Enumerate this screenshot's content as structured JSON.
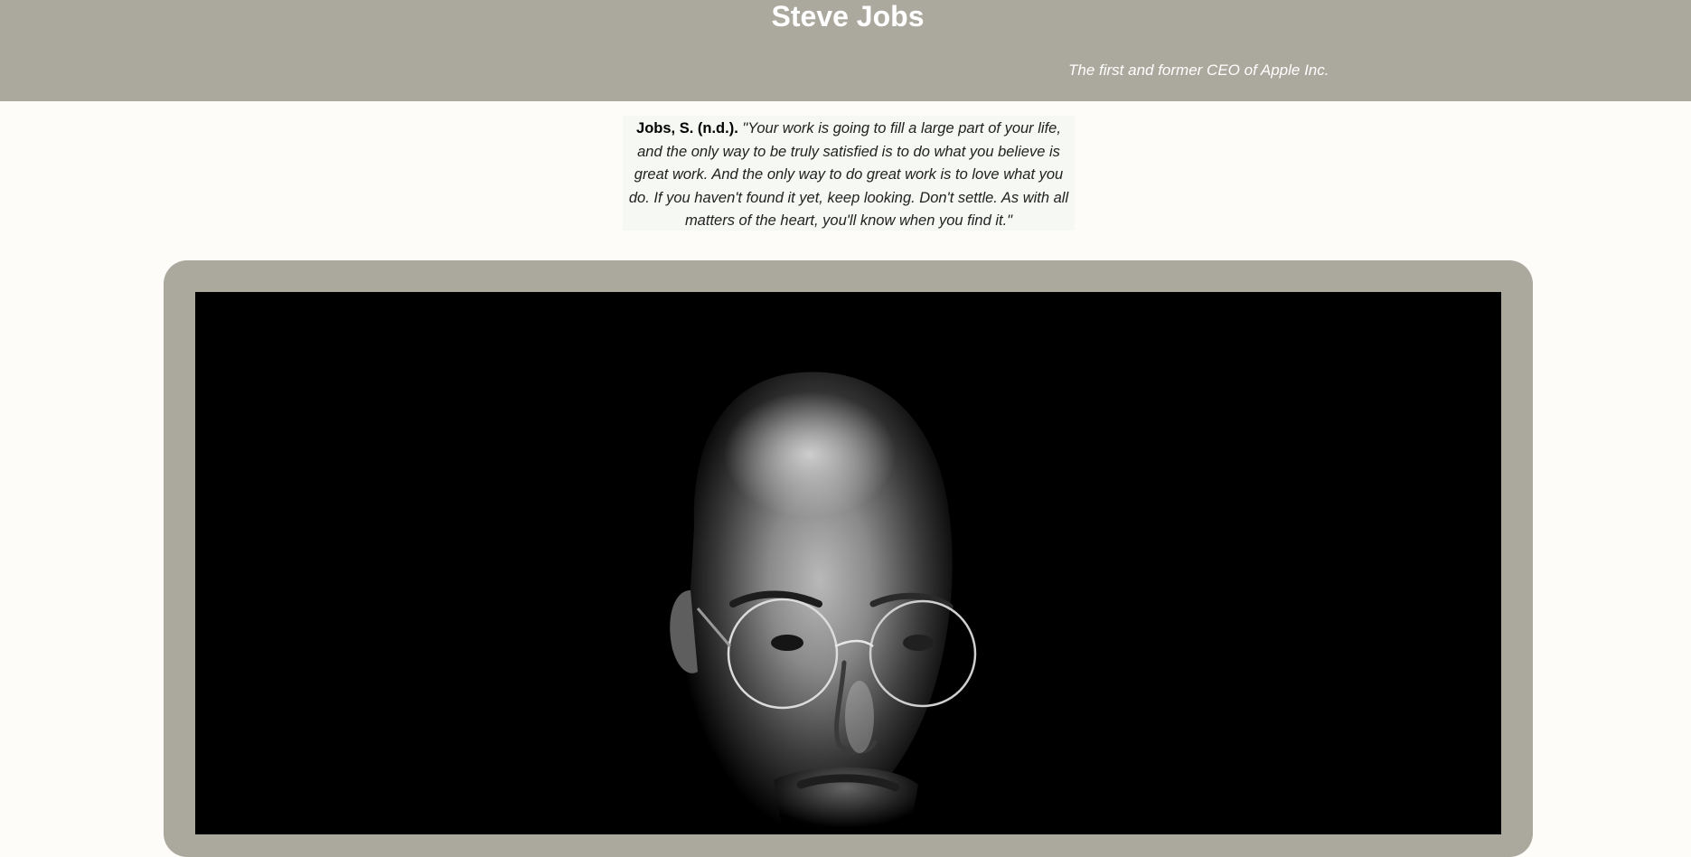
{
  "header": {
    "title": "Steve Jobs",
    "tagline": "The first and former CEO of Apple Inc."
  },
  "quote": {
    "author": "Jobs, S. (n.d.).",
    "text": "\"Your work is going to fill a large part of your life, and the only way to be truly satisfied is to do what you believe is great work. And the only way to do great work is to love what you do. If you haven't found it yet, keep looking. Don't settle. As with all matters of the heart, you'll know when you find it.\""
  },
  "image": {
    "description_icon": "portrait-photo"
  },
  "colors": {
    "header_bg": "#aba89d",
    "page_bg": "#fdfcf8",
    "frame_bg": "#aba89d",
    "quote_bg": "#f6f8f3"
  }
}
